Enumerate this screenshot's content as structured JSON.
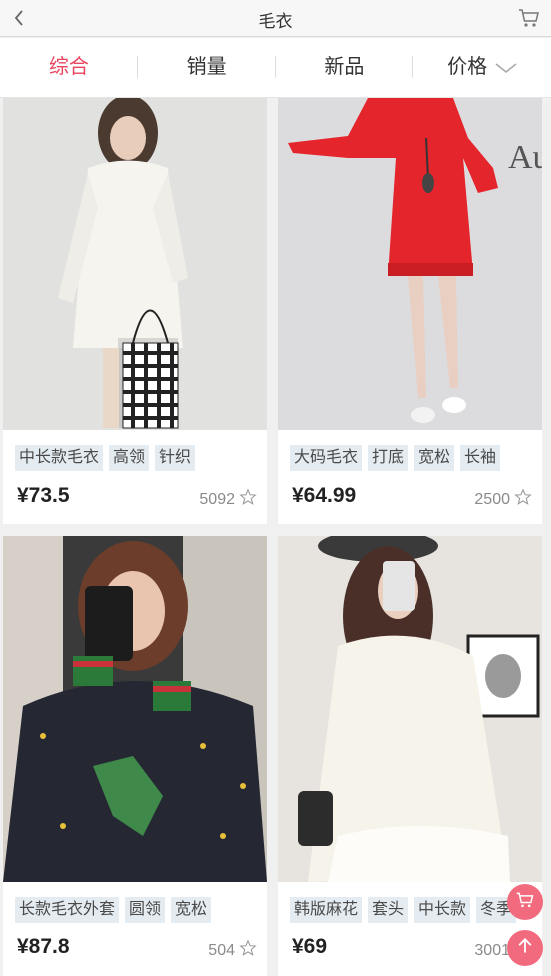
{
  "header": {
    "back_icon": "chevron-left-icon",
    "title": "毛衣",
    "cart_icon": "cart-icon"
  },
  "tabs": [
    {
      "label": "综合",
      "active": true
    },
    {
      "label": "销量",
      "active": false
    },
    {
      "label": "新品",
      "active": false
    },
    {
      "label": "价格",
      "active": false
    }
  ],
  "products": [
    {
      "image": "woman in long white cable-knit sweater dress holding checkered tote",
      "tags": [
        "中长款毛衣",
        "高领",
        "针织"
      ],
      "price": "¥73.5",
      "sales": "5092"
    },
    {
      "image": "woman in red hooded sweater dress",
      "tags": [
        "大码毛衣",
        "打底",
        "宽松",
        "长袖"
      ],
      "price": "¥64.99",
      "sales": "2500"
    },
    {
      "image": "woman taking mirror selfie in black embroidered sweater",
      "tags": [
        "长款毛衣外套",
        "圆领",
        "宽松"
      ],
      "price": "¥87.8",
      "sales": "504"
    },
    {
      "image": "woman in cream knit sweater dress taking selfie",
      "tags": [
        "韩版麻花",
        "套头",
        "中长款",
        "冬季"
      ],
      "price": "¥69",
      "sales": "3001"
    }
  ],
  "floating": {
    "cart_icon": "cart-icon",
    "top_icon": "arrow-up-icon"
  },
  "colors": {
    "accent": "#e8455f",
    "tag_bg": "#e4ecf2",
    "fab": "#f16a7e"
  }
}
